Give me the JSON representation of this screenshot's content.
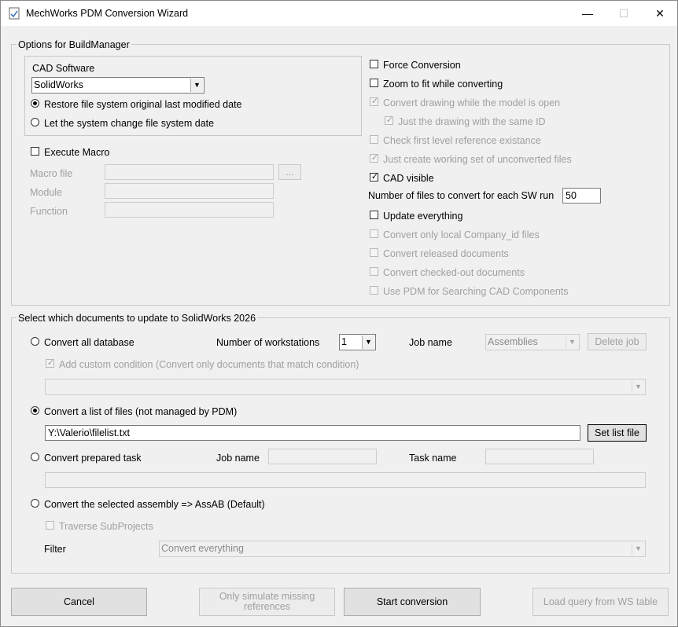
{
  "window": {
    "title": "MechWorks PDM Conversion Wizard",
    "minimize": "—",
    "maximize": "☐",
    "close": "✕"
  },
  "options": {
    "group_label": "Options for BuildManager",
    "cad_software": {
      "label": "CAD Software",
      "selected": "SolidWorks",
      "restore_date": "Restore file system original last modified date",
      "system_date": "Let the system change file system date"
    },
    "macro": {
      "execute_label": "Execute Macro",
      "file_label": "Macro file",
      "browse": "...",
      "module_label": "Module",
      "function_label": "Function"
    },
    "right": {
      "force_conversion": "Force Conversion",
      "zoom_fit": "Zoom to fit while converting",
      "convert_drawing": "Convert drawing while the model is open",
      "just_drawing": "Just the drawing with the same ID",
      "check_ref": "Check first level reference existance",
      "just_create": "Just create working set of unconverted files",
      "cad_visible": "CAD visible",
      "files_per_run_label": "Number of files to convert  for each  SW run",
      "files_per_run_value": "50",
      "update_everything": "Update everything",
      "local_company": "Convert only local Company_id files",
      "released_docs": "Convert released documents",
      "checked_out": "Convert checked-out documents",
      "use_pdm": "Use PDM for Searching CAD Components"
    }
  },
  "select": {
    "group_label": "Select which documents to update to  SolidWorks 2026",
    "all_db": {
      "label": "Convert all database",
      "workstations_label": "Number of workstations",
      "workstations_value": "1",
      "job_label": "Job name",
      "job_value": "Assemblies",
      "delete_job": "Delete job",
      "custom_condition": "Add custom condition (Convert only documents that match condition)"
    },
    "list": {
      "label": "Convert a list of files (not managed by PDM)",
      "path": "Y:\\Valerio\\filelist.txt",
      "set_list": "Set list file"
    },
    "prepared": {
      "label": "Convert prepared task",
      "job_label": "Job name",
      "task_label": "Task name"
    },
    "assembly": {
      "label": "Convert the selected  assembly  =>  AssAB (Default)",
      "traverse": "Traverse SubProjects",
      "filter_label": "Filter",
      "filter_value": "Convert everything"
    }
  },
  "footer": {
    "cancel": "Cancel",
    "simulate": "Only simulate missing references",
    "start": "Start conversion",
    "load_query": "Load query from WS table"
  }
}
